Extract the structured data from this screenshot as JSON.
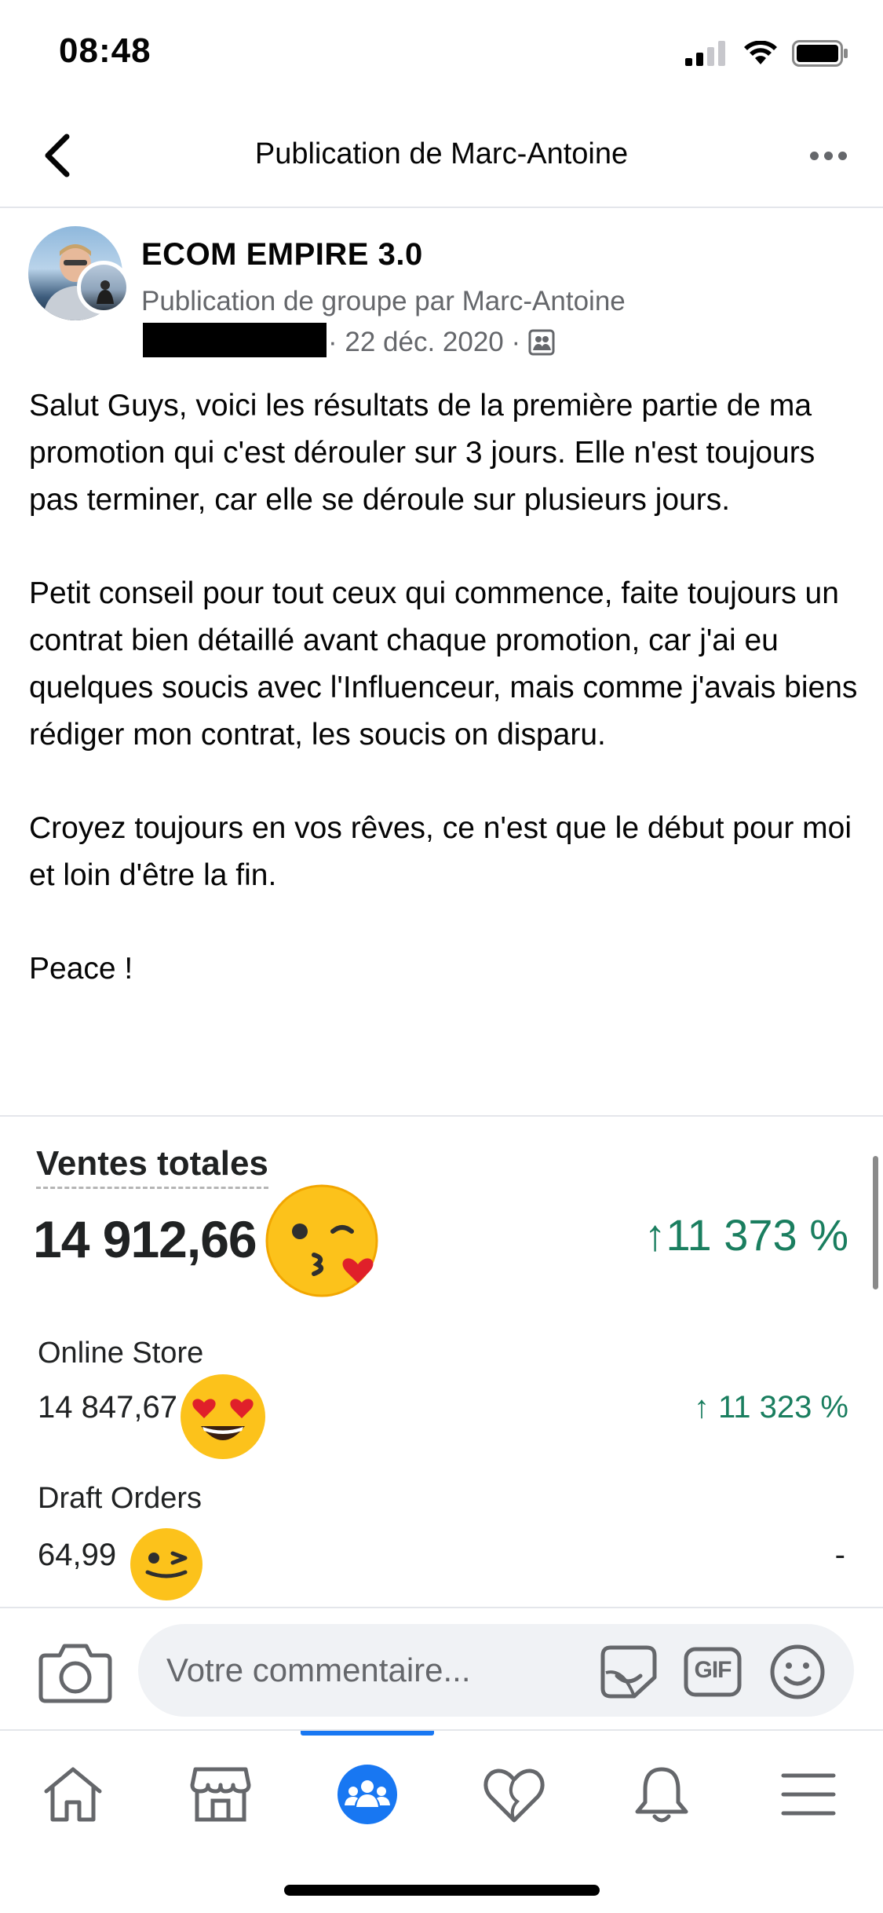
{
  "status_bar": {
    "time": "08:48"
  },
  "header": {
    "title": "Publication de Marc-Antoine"
  },
  "post": {
    "group_name": "ECOM EMPIRE 3.0",
    "meta_prefix": "Publication de groupe par Marc-Antoine",
    "date": "· 22 déc. 2020 ·",
    "paragraphs": [
      "Salut Guys, voici les résultats de la première partie de ma promotion qui c'est dérouler sur 3 jours. Elle n'est toujours pas terminer, car elle se déroule sur plusieurs jours.",
      "Petit conseil pour tout ceux qui commence, faite toujours un contrat bien détaillé avant chaque promotion, car j'ai eu quelques soucis avec l'Influenceur, mais comme j'avais biens rédiger mon contrat, les soucis on disparu.",
      "Croyez toujours en vos rêves, ce n'est que le début pour moi et loin d'être la fin.",
      "Peace !"
    ]
  },
  "attachment": {
    "total_label": "Ventes totales",
    "total_value": "14 912,66",
    "total_change": "↑11 373 %",
    "online_label": "Online Store",
    "online_value": "14 847,67",
    "online_change": "↑ 11 323 %",
    "draft_label": "Draft Orders",
    "draft_value": "64,99",
    "draft_change": "-",
    "emojis": [
      "kissing-heart-emoji",
      "heart-eyes-emoji",
      "wink-emoji"
    ]
  },
  "comment_bar": {
    "placeholder": "Votre commentaire...",
    "gif_label": "GIF"
  },
  "tab_bar": {
    "tabs": [
      "home-icon",
      "marketplace-icon",
      "groups-icon",
      "dating-icon",
      "notifications-icon",
      "menu-icon"
    ],
    "active_tab": "groups-icon",
    "accent_color": "#1877f2"
  }
}
